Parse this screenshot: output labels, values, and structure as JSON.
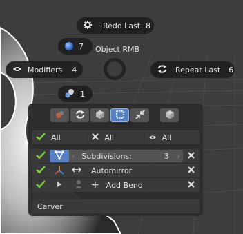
{
  "pie_menu": {
    "redo_last": {
      "label": "Redo Last",
      "count": "8",
      "icon": "gear-icon"
    },
    "object": {
      "count": "7",
      "label": "Object RMB",
      "icon": "sphere-icon"
    },
    "modifiers": {
      "label": "Modifiers",
      "count": "4",
      "icon": "eye-icon"
    },
    "repeat_last": {
      "label": "Repeat Last",
      "count": "6",
      "icon": "refresh-icon"
    },
    "spheres": {
      "count": "1",
      "icon": "spheres-icon"
    }
  },
  "panel": {
    "filters": [
      {
        "label": "All",
        "icon": "check-icon"
      },
      {
        "label": "All",
        "icon": "x-icon"
      },
      {
        "label": "All",
        "icon": "eye-icon"
      }
    ],
    "modifiers": [
      {
        "name": "Subdivisions:",
        "value": "3"
      },
      {
        "name": "Automirror"
      },
      {
        "name": "Add Bend"
      }
    ],
    "footer": "Carver"
  },
  "colors": {
    "accent": "#5680c2",
    "check": "#7ed140",
    "background": "#3d3d3d"
  }
}
